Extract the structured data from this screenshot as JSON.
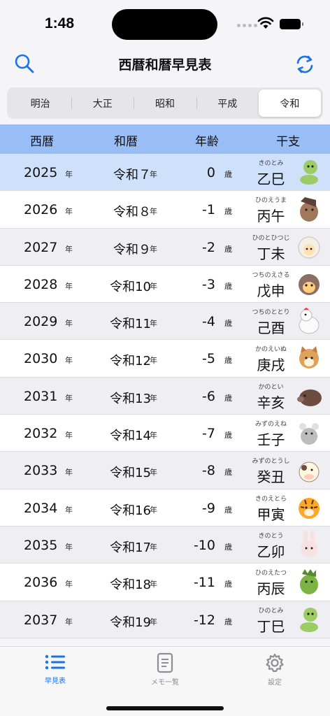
{
  "status": {
    "time": "1:48"
  },
  "nav": {
    "title": "西暦和暦早見表"
  },
  "eras": [
    "明治",
    "大正",
    "昭和",
    "平成",
    "令和"
  ],
  "selected_era_index": 4,
  "headers": {
    "seireki": "西暦",
    "wareki": "和暦",
    "age": "年齢",
    "kanshi": "干支"
  },
  "units": {
    "year": "年",
    "age": "歳"
  },
  "rows": [
    {
      "year": "2025",
      "wareki": "令和７",
      "age": "0",
      "ruby": "きのとみ",
      "kanshi": "乙巳",
      "animal": "snake",
      "style": "current"
    },
    {
      "year": "2026",
      "wareki": "令和８",
      "age": "-1",
      "ruby": "ひのえうま",
      "kanshi": "丙午",
      "animal": "horse",
      "style": "white"
    },
    {
      "year": "2027",
      "wareki": "令和９",
      "age": "-2",
      "ruby": "ひのとひつじ",
      "kanshi": "丁未",
      "animal": "sheep",
      "style": "alt"
    },
    {
      "year": "2028",
      "wareki": "令和10",
      "age": "-3",
      "ruby": "つちのえさる",
      "kanshi": "戊申",
      "animal": "monkey",
      "style": "white"
    },
    {
      "year": "2029",
      "wareki": "令和11",
      "age": "-4",
      "ruby": "つちのととり",
      "kanshi": "己酉",
      "animal": "rooster",
      "style": "alt"
    },
    {
      "year": "2030",
      "wareki": "令和12",
      "age": "-5",
      "ruby": "かのえいぬ",
      "kanshi": "庚戌",
      "animal": "dog",
      "style": "white"
    },
    {
      "year": "2031",
      "wareki": "令和13",
      "age": "-6",
      "ruby": "かのとい",
      "kanshi": "辛亥",
      "animal": "boar",
      "style": "alt"
    },
    {
      "year": "2032",
      "wareki": "令和14",
      "age": "-7",
      "ruby": "みずのえね",
      "kanshi": "壬子",
      "animal": "rat",
      "style": "white"
    },
    {
      "year": "2033",
      "wareki": "令和15",
      "age": "-8",
      "ruby": "みずのとうし",
      "kanshi": "癸丑",
      "animal": "ox",
      "style": "alt"
    },
    {
      "year": "2034",
      "wareki": "令和16",
      "age": "-9",
      "ruby": "きのえとら",
      "kanshi": "甲寅",
      "animal": "tiger",
      "style": "white"
    },
    {
      "year": "2035",
      "wareki": "令和17",
      "age": "-10",
      "ruby": "きのとう",
      "kanshi": "乙卯",
      "animal": "rabbit",
      "style": "alt"
    },
    {
      "year": "2036",
      "wareki": "令和18",
      "age": "-11",
      "ruby": "ひのえたつ",
      "kanshi": "丙辰",
      "animal": "dragon",
      "style": "white"
    },
    {
      "year": "2037",
      "wareki": "令和19",
      "age": "-12",
      "ruby": "ひのとみ",
      "kanshi": "丁巳",
      "animal": "snake",
      "style": "alt"
    }
  ],
  "tabs": [
    {
      "label": "早見表",
      "icon": "list-icon",
      "active": true
    },
    {
      "label": "メモ一覧",
      "icon": "memo-icon",
      "active": false
    },
    {
      "label": "設定",
      "icon": "gear-icon",
      "active": false
    }
  ],
  "colors": {
    "accent": "#1a73e8",
    "header_bg": "#99bdf5",
    "current_row": "#cfe0fb",
    "alt_row": "#eeeef3"
  }
}
